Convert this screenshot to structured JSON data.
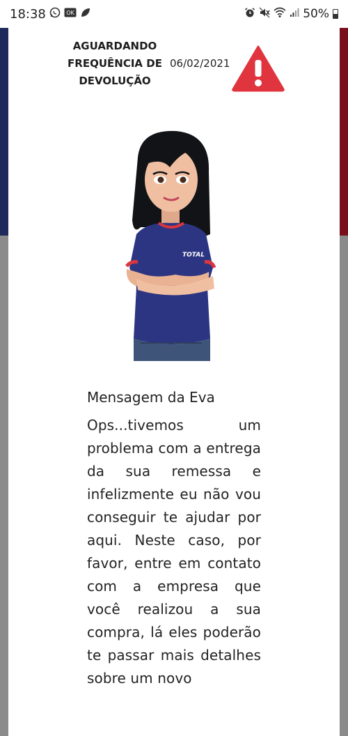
{
  "status_bar": {
    "time": "18:38",
    "left_icons": [
      "whatsapp-icon",
      "ok-app-icon",
      "leaf-icon"
    ],
    "right_icons": [
      "alarm-icon",
      "mute-icon",
      "wifi-icon",
      "signal-icon"
    ],
    "battery": "50%"
  },
  "header": {
    "status_lines": [
      "AGUARDANDO",
      "FREQUÊNCIA DE",
      "DEVOLUÇÃO"
    ],
    "date": "06/02/2021",
    "alert_color": "#e0343f"
  },
  "message": {
    "title": "Mensagem da Eva",
    "body": "Ops...tivemos um problema com a entrega da sua remessa e infelizmente eu não vou conseguir te ajudar por aqui. Neste caso, por favor, entre em contato com a empresa que você realizou a sua compra, lá eles poderão te passar mais detalhes sobre um novo"
  },
  "avatar": {
    "shirt_logo": "TOTAL"
  }
}
